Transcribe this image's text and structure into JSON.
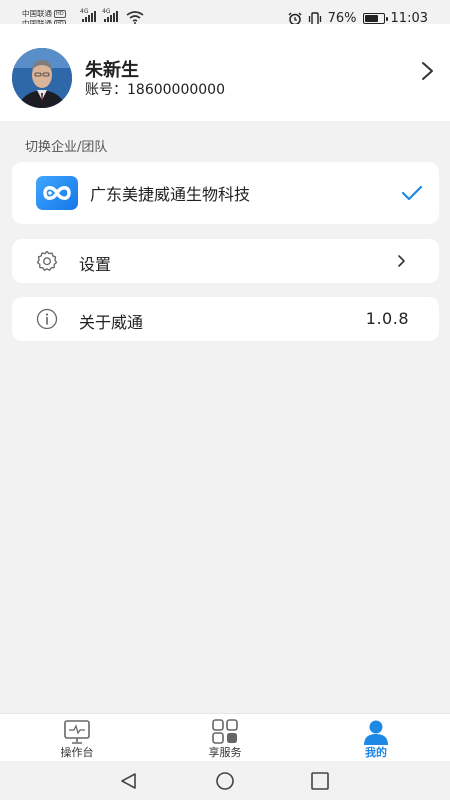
{
  "status_bar": {
    "carrier_1": "中国联通",
    "carrier_2": "中国联通",
    "hd_tag": "HD",
    "network_label": "4G",
    "battery_percent": "76%",
    "battery_level": 0.76,
    "time": "11:03"
  },
  "profile": {
    "name": "朱新生",
    "account_label": "账号：",
    "account_number": "18600000000"
  },
  "switch_section": {
    "title": "切换企业/团队"
  },
  "company": {
    "name": "广东美捷威通生物科技",
    "selected": true
  },
  "menu": {
    "settings_label": "设置",
    "about_label": "关于威通",
    "version": "1.0.8"
  },
  "tabbar": {
    "tabs": [
      {
        "label": "操作台",
        "icon": "monitor-icon"
      },
      {
        "label": "享服务",
        "icon": "grid-icon"
      },
      {
        "label": "我的",
        "icon": "person-icon",
        "active": true
      }
    ],
    "active_color": "#1e88e5"
  },
  "colors": {
    "accent": "#1e88e5",
    "background": "#f2f2f2"
  }
}
